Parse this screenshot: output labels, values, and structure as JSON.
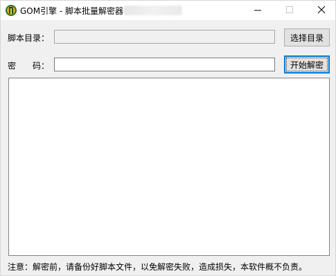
{
  "window": {
    "title": "GOM引擎 - 脚本批量解密器"
  },
  "script_dir": {
    "label": "脚本目录：",
    "value": "",
    "button_label": "选择目录"
  },
  "password": {
    "label": "密　　码：",
    "value": "",
    "button_label": "开始解密"
  },
  "log": {
    "value": ""
  },
  "notice": "注意：解密前，请备份好脚本文件，以免解密失败，造成损失，本软件概不负责。"
}
